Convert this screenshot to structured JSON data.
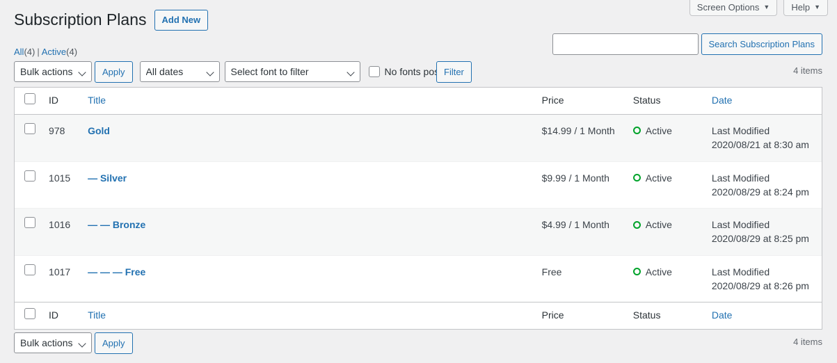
{
  "screen_meta": {
    "screen_options_label": "Screen Options",
    "help_label": "Help",
    "caret": "▼"
  },
  "header": {
    "title": "Subscription Plans",
    "add_new_label": "Add New"
  },
  "views": {
    "all_label": "All",
    "all_count": "(4)",
    "separator": "|",
    "active_label": "Active",
    "active_count": "(4)"
  },
  "search": {
    "value": "",
    "placeholder": "",
    "button_label": "Search Subscription Plans"
  },
  "tablenav_top": {
    "bulk_actions_label": "Bulk actions",
    "apply_label": "Apply",
    "date_filter_label": "All dates",
    "font_filter_label": "Select font to filter",
    "no_fonts_checkbox_label": "No fonts posts",
    "no_fonts_checked": false,
    "filter_label": "Filter",
    "displaying_num": "4 items"
  },
  "table": {
    "columns": {
      "id": "ID",
      "title": "Title",
      "price": "Price",
      "status": "Status",
      "date": "Date"
    },
    "rows": [
      {
        "id": "978",
        "title": "Gold",
        "prefix": "",
        "price": "$14.99 / 1 Month",
        "status": "Active",
        "date_label": "Last Modified",
        "date_value": "2020/08/21 at 8:30 am"
      },
      {
        "id": "1015",
        "title": "Silver",
        "prefix": "— ",
        "price": "$9.99 / 1 Month",
        "status": "Active",
        "date_label": "Last Modified",
        "date_value": "2020/08/29 at 8:24 pm"
      },
      {
        "id": "1016",
        "title": "Bronze",
        "prefix": "— — ",
        "price": "$4.99 / 1 Month",
        "status": "Active",
        "date_label": "Last Modified",
        "date_value": "2020/08/29 at 8:25 pm"
      },
      {
        "id": "1017",
        "title": "Free",
        "prefix": "— — — ",
        "price": "Free",
        "status": "Active",
        "date_label": "Last Modified",
        "date_value": "2020/08/29 at 8:26 pm"
      }
    ]
  },
  "tablenav_bottom": {
    "bulk_actions_label": "Bulk actions",
    "apply_label": "Apply",
    "displaying_num": "4 items"
  },
  "colors": {
    "link": "#2271b1",
    "status_active": "#00a32a",
    "background": "#f0f0f1",
    "row_alt": "#f6f7f7"
  }
}
